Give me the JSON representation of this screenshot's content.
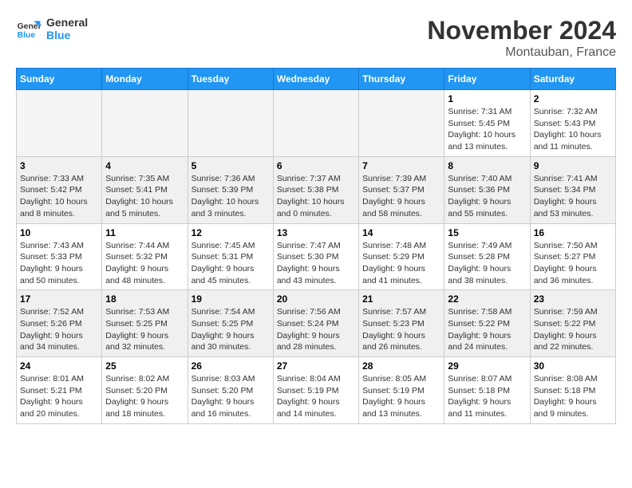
{
  "logo": {
    "line1": "General",
    "line2": "Blue"
  },
  "title": "November 2024",
  "location": "Montauban, France",
  "weekdays": [
    "Sunday",
    "Monday",
    "Tuesday",
    "Wednesday",
    "Thursday",
    "Friday",
    "Saturday"
  ],
  "weeks": [
    [
      {
        "day": "",
        "info": ""
      },
      {
        "day": "",
        "info": ""
      },
      {
        "day": "",
        "info": ""
      },
      {
        "day": "",
        "info": ""
      },
      {
        "day": "",
        "info": ""
      },
      {
        "day": "1",
        "info": "Sunrise: 7:31 AM\nSunset: 5:45 PM\nDaylight: 10 hours\nand 13 minutes."
      },
      {
        "day": "2",
        "info": "Sunrise: 7:32 AM\nSunset: 5:43 PM\nDaylight: 10 hours\nand 11 minutes."
      }
    ],
    [
      {
        "day": "3",
        "info": "Sunrise: 7:33 AM\nSunset: 5:42 PM\nDaylight: 10 hours\nand 8 minutes."
      },
      {
        "day": "4",
        "info": "Sunrise: 7:35 AM\nSunset: 5:41 PM\nDaylight: 10 hours\nand 5 minutes."
      },
      {
        "day": "5",
        "info": "Sunrise: 7:36 AM\nSunset: 5:39 PM\nDaylight: 10 hours\nand 3 minutes."
      },
      {
        "day": "6",
        "info": "Sunrise: 7:37 AM\nSunset: 5:38 PM\nDaylight: 10 hours\nand 0 minutes."
      },
      {
        "day": "7",
        "info": "Sunrise: 7:39 AM\nSunset: 5:37 PM\nDaylight: 9 hours\nand 58 minutes."
      },
      {
        "day": "8",
        "info": "Sunrise: 7:40 AM\nSunset: 5:36 PM\nDaylight: 9 hours\nand 55 minutes."
      },
      {
        "day": "9",
        "info": "Sunrise: 7:41 AM\nSunset: 5:34 PM\nDaylight: 9 hours\nand 53 minutes."
      }
    ],
    [
      {
        "day": "10",
        "info": "Sunrise: 7:43 AM\nSunset: 5:33 PM\nDaylight: 9 hours\nand 50 minutes."
      },
      {
        "day": "11",
        "info": "Sunrise: 7:44 AM\nSunset: 5:32 PM\nDaylight: 9 hours\nand 48 minutes."
      },
      {
        "day": "12",
        "info": "Sunrise: 7:45 AM\nSunset: 5:31 PM\nDaylight: 9 hours\nand 45 minutes."
      },
      {
        "day": "13",
        "info": "Sunrise: 7:47 AM\nSunset: 5:30 PM\nDaylight: 9 hours\nand 43 minutes."
      },
      {
        "day": "14",
        "info": "Sunrise: 7:48 AM\nSunset: 5:29 PM\nDaylight: 9 hours\nand 41 minutes."
      },
      {
        "day": "15",
        "info": "Sunrise: 7:49 AM\nSunset: 5:28 PM\nDaylight: 9 hours\nand 38 minutes."
      },
      {
        "day": "16",
        "info": "Sunrise: 7:50 AM\nSunset: 5:27 PM\nDaylight: 9 hours\nand 36 minutes."
      }
    ],
    [
      {
        "day": "17",
        "info": "Sunrise: 7:52 AM\nSunset: 5:26 PM\nDaylight: 9 hours\nand 34 minutes."
      },
      {
        "day": "18",
        "info": "Sunrise: 7:53 AM\nSunset: 5:25 PM\nDaylight: 9 hours\nand 32 minutes."
      },
      {
        "day": "19",
        "info": "Sunrise: 7:54 AM\nSunset: 5:25 PM\nDaylight: 9 hours\nand 30 minutes."
      },
      {
        "day": "20",
        "info": "Sunrise: 7:56 AM\nSunset: 5:24 PM\nDaylight: 9 hours\nand 28 minutes."
      },
      {
        "day": "21",
        "info": "Sunrise: 7:57 AM\nSunset: 5:23 PM\nDaylight: 9 hours\nand 26 minutes."
      },
      {
        "day": "22",
        "info": "Sunrise: 7:58 AM\nSunset: 5:22 PM\nDaylight: 9 hours\nand 24 minutes."
      },
      {
        "day": "23",
        "info": "Sunrise: 7:59 AM\nSunset: 5:22 PM\nDaylight: 9 hours\nand 22 minutes."
      }
    ],
    [
      {
        "day": "24",
        "info": "Sunrise: 8:01 AM\nSunset: 5:21 PM\nDaylight: 9 hours\nand 20 minutes."
      },
      {
        "day": "25",
        "info": "Sunrise: 8:02 AM\nSunset: 5:20 PM\nDaylight: 9 hours\nand 18 minutes."
      },
      {
        "day": "26",
        "info": "Sunrise: 8:03 AM\nSunset: 5:20 PM\nDaylight: 9 hours\nand 16 minutes."
      },
      {
        "day": "27",
        "info": "Sunrise: 8:04 AM\nSunset: 5:19 PM\nDaylight: 9 hours\nand 14 minutes."
      },
      {
        "day": "28",
        "info": "Sunrise: 8:05 AM\nSunset: 5:19 PM\nDaylight: 9 hours\nand 13 minutes."
      },
      {
        "day": "29",
        "info": "Sunrise: 8:07 AM\nSunset: 5:18 PM\nDaylight: 9 hours\nand 11 minutes."
      },
      {
        "day": "30",
        "info": "Sunrise: 8:08 AM\nSunset: 5:18 PM\nDaylight: 9 hours\nand 9 minutes."
      }
    ]
  ]
}
